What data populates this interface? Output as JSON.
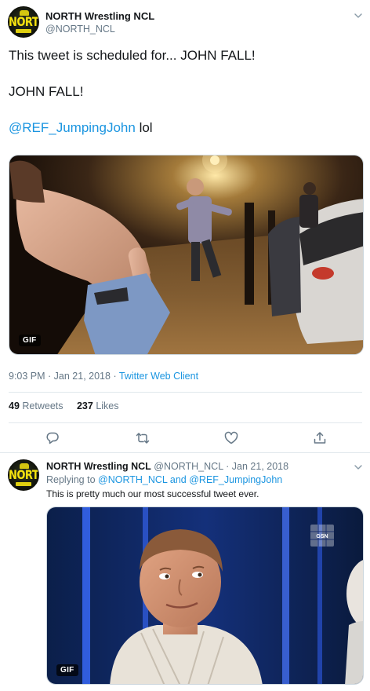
{
  "main_tweet": {
    "display_name": "NORTH Wrestling NCL",
    "handle": "@NORTH_NCL",
    "avatar_text": "NORTH",
    "text_line1": "This tweet is scheduled for... JOHN FALL!",
    "text_line2": "JOHN FALL!",
    "mention": "@REF_JumpingJohn",
    "mention_suffix": " lol",
    "gif_label": "GIF",
    "time": "9:03 PM",
    "date": "Jan 21, 2018",
    "separator": " · ",
    "source": "Twitter Web Client",
    "retweets_count": "49",
    "retweets_label": "Retweets",
    "likes_count": "237",
    "likes_label": "Likes",
    "icons": [
      "reply-icon",
      "retweet-icon",
      "like-icon",
      "share-icon",
      "caret-down-icon"
    ]
  },
  "reply_tweet": {
    "display_name": "NORTH Wrestling NCL",
    "handle": "@NORTH_NCL",
    "date": "Jan 21, 2018",
    "separator": " · ",
    "avatar_text": "NORTH",
    "replying_prefix": "Replying to ",
    "reply_to_1": "@NORTH_NCL",
    "reply_and": " and ",
    "reply_to_2": "@REF_JumpingJohn",
    "text": "This is pretty much our most successful tweet ever.",
    "gif_label": "GIF",
    "channel_logo": "GSN"
  },
  "colors": {
    "link": "#1b95e0",
    "muted": "#657786",
    "text": "#14171a",
    "border": "#e1e8ed",
    "avatar_logo": "#f5e30f"
  }
}
